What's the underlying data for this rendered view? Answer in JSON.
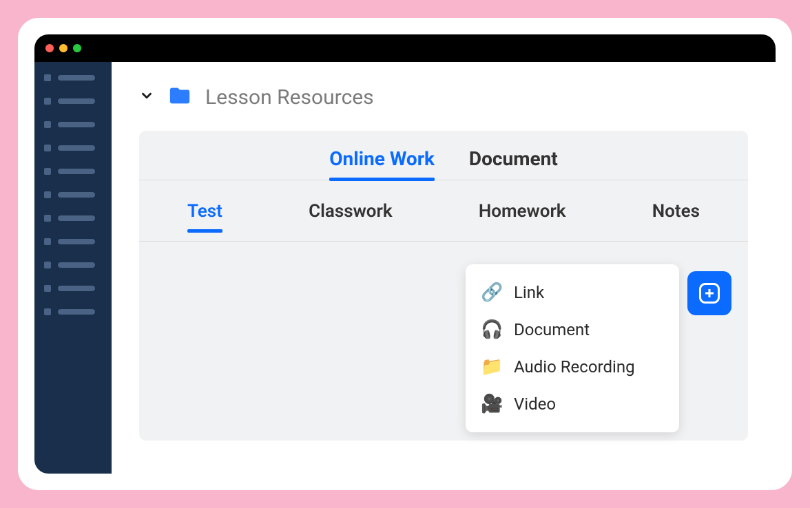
{
  "breadcrumb": {
    "title": "Lesson Resources"
  },
  "tabs_primary": [
    {
      "label": "Online Work",
      "active": true
    },
    {
      "label": "Document",
      "active": false
    }
  ],
  "tabs_secondary": [
    {
      "label": "Test",
      "active": true
    },
    {
      "label": "Classwork",
      "active": false
    },
    {
      "label": "Homework",
      "active": false
    },
    {
      "label": "Notes",
      "active": false
    }
  ],
  "add_menu": [
    {
      "icon": "🔗",
      "label": "Link"
    },
    {
      "icon": "🎧",
      "label": "Document"
    },
    {
      "icon": "📁",
      "label": "Audio Recording"
    },
    {
      "icon": "🎥",
      "label": "Video"
    }
  ],
  "colors": {
    "accent": "#0b6bff",
    "sidebar": "#1a2f4b",
    "frame": "#f9b5cc"
  }
}
